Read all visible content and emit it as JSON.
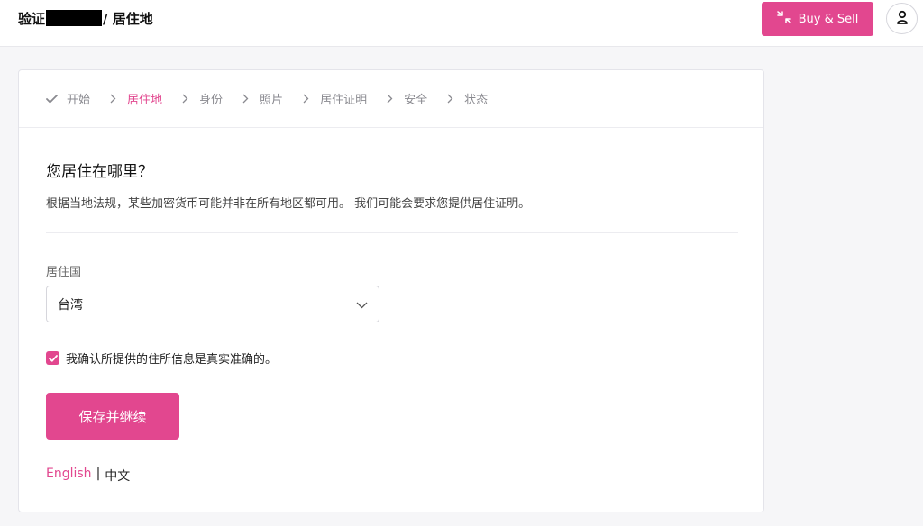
{
  "header": {
    "title_prefix": "验证",
    "title_suffix": "/ 居住地",
    "buy_sell_label": "Buy & Sell",
    "buy_sell_icon": "arrows-in-icon",
    "profile_icon": "user-icon"
  },
  "steps": [
    {
      "label": "开始",
      "state": "done"
    },
    {
      "label": "居住地",
      "state": "active"
    },
    {
      "label": "身份",
      "state": "pending"
    },
    {
      "label": "照片",
      "state": "pending"
    },
    {
      "label": "居住证明",
      "state": "pending"
    },
    {
      "label": "安全",
      "state": "pending"
    },
    {
      "label": "状态",
      "state": "pending"
    }
  ],
  "form": {
    "question": "您居住在哪里？",
    "description": "根据当地法规，某些加密货币可能并非在所有地区都可用。 我们可能会要求您提供居住证明。",
    "country_label": "居住国",
    "country_value": "台湾",
    "confirm_text": "我确认所提供的住所信息是真实准确的。",
    "confirm_checked": true,
    "submit_label": "保存并继续"
  },
  "language": {
    "english": "English",
    "separator": "|",
    "chinese": "中文"
  },
  "colors": {
    "accent": "#e2478f",
    "background": "#f6f6f8",
    "card": "#ffffff"
  }
}
